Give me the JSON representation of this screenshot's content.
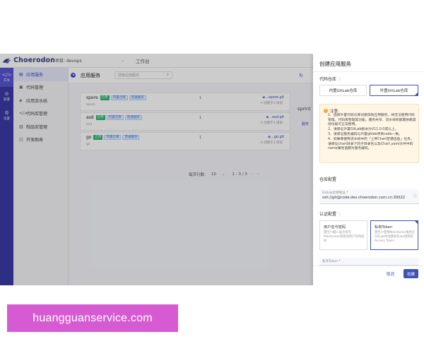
{
  "header": {
    "logo_text": "Choerodon",
    "project_label": "项目: devops",
    "workbench": "工作台"
  },
  "left_nav": [
    {
      "icon": "</>",
      "label": "开发",
      "active": true
    },
    {
      "icon": "⊘",
      "label": "部署",
      "active": false
    },
    {
      "icon": "⚙",
      "label": "设置",
      "active": false
    }
  ],
  "sub_menu": [
    {
      "icon": "▤",
      "label": "应用服务",
      "active": true
    },
    {
      "icon": "▣",
      "label": "代码管理",
      "active": false
    },
    {
      "icon": "◈",
      "label": "应用流水线",
      "active": false
    },
    {
      "icon": "</>",
      "label": "代码库管理",
      "active": false
    },
    {
      "icon": "▥",
      "label": "制品库管理",
      "active": false
    },
    {
      "icon": "◫",
      "label": "开发图表",
      "active": false
    }
  ],
  "main": {
    "title": "应用服务",
    "search_placeholder": "搜索应用服务",
    "services": [
      {
        "name": "spore",
        "code": "spore",
        "tags": [
          "启用",
          "内置仓库",
          "普通服务"
        ],
        "count": "1",
        "url": "◈...spore.git",
        "updated": "A 创建于2 周前"
      },
      {
        "name": "asd",
        "code": "asd",
        "tags": [
          "启用",
          "内置仓库",
          "普通服务"
        ],
        "count": "1",
        "url": "◈...asd.git",
        "updated": "A 创建于3 周前"
      },
      {
        "name": "go",
        "code": "go",
        "tags": [
          "启用",
          "内置仓库",
          "普通服务"
        ],
        "count": "1",
        "url": "◈...go.git",
        "updated": "A 创建于3 周前"
      }
    ],
    "pagination": {
      "label": "每页行数:",
      "size": "10",
      "range": "1 - 3 / 3",
      "prev": "‹",
      "next": "›"
    },
    "sprint_label": "sprint",
    "service_link": "服务"
  },
  "drawer": {
    "title": "创建应用服务",
    "repo_label": "代码仓库",
    "repo_options": [
      "内置GitLab仓库",
      "外置GitLab仓库"
    ],
    "notice_title": "注意:",
    "notice_lines": [
      "1、选择外置代码仓库创建得到应用服务，将无法使用代码管理、代码库管理等功能，服务共享、流水线和部署依赖其他功能可正常使用。",
      "2、请保证外置GitLab版本为V11.0.0或以上。",
      "3、请保证服务编码与外置gitlab项目code一致。",
      "4、如果要使用流水线中的「上传Chart至猪齿鱼」任务，请保证chart目录下的子目录名以及Chart.yaml文件中的name属性值都为服务编码。"
    ],
    "repo_config_label": "仓库配置",
    "address_label": "GitLab仓库地址",
    "address_value": "ssh://git@code.dev.choerodon.com.cn:30022",
    "auth_label": "认证配置",
    "auth_options": [
      {
        "title": "用户名与密码",
        "desc": "需至少输入该仓库内Maintainer角色的用户名和密码"
      },
      {
        "title": "私有Token",
        "desc": "需至少使用Maintainer角色在GitLab中创建具有api权限的Access Token"
      }
    ],
    "token_label": "私有Token",
    "cancel": "取消",
    "create": "创建"
  },
  "watermark": "huangguanservice.com",
  "colors": {
    "primary": "#3f51b5",
    "nav_bg": "#3a3aa6",
    "tag_green": "#2bb673",
    "watermark_bg": "#d65bd2",
    "notice_bg": "#fff6e6"
  }
}
